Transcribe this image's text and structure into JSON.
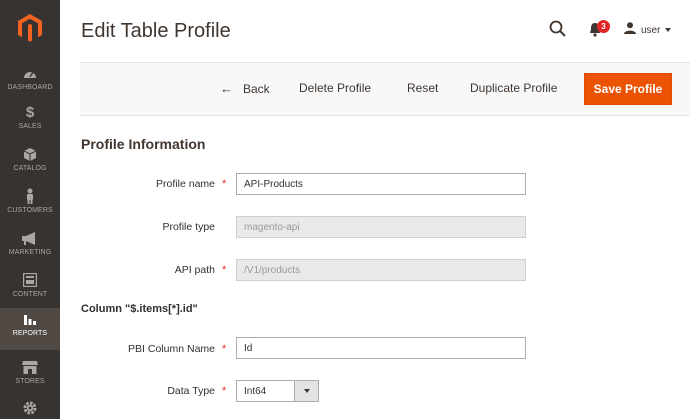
{
  "sidebar": {
    "items": [
      {
        "label": "DASHBOARD",
        "icon": "dashboard-icon"
      },
      {
        "label": "SALES",
        "icon": "dollar-icon"
      },
      {
        "label": "CATALOG",
        "icon": "box-icon"
      },
      {
        "label": "CUSTOMERS",
        "icon": "person-icon"
      },
      {
        "label": "MARKETING",
        "icon": "megaphone-icon"
      },
      {
        "label": "CONTENT",
        "icon": "layout-icon"
      },
      {
        "label": "REPORTS",
        "icon": "bar-chart-icon",
        "active": true
      },
      {
        "label": "STORES",
        "icon": "store-icon"
      },
      {
        "label": "",
        "icon": "gear-icon"
      }
    ]
  },
  "header": {
    "title": "Edit Table Profile",
    "notifications_count": "3",
    "user_label": "user"
  },
  "actions": {
    "back": "Back",
    "delete": "Delete Profile",
    "reset": "Reset",
    "duplicate": "Duplicate Profile",
    "save": "Save Profile"
  },
  "form": {
    "section_title": "Profile Information",
    "profile_name": {
      "label": "Profile name",
      "value": "API-Products"
    },
    "profile_type": {
      "label": "Profile type",
      "value": "magento-api"
    },
    "api_path": {
      "label": "API path",
      "value": "/V1/products"
    },
    "column_title": "Column \"$.items[*].id\"",
    "pbi_column_name": {
      "label": "PBI Column Name",
      "value": "Id"
    },
    "data_type": {
      "label": "Data Type",
      "value": "Int64"
    }
  },
  "colors": {
    "sidebar_bg": "#373330",
    "accent": "#eb5202",
    "required": "#e22626"
  }
}
